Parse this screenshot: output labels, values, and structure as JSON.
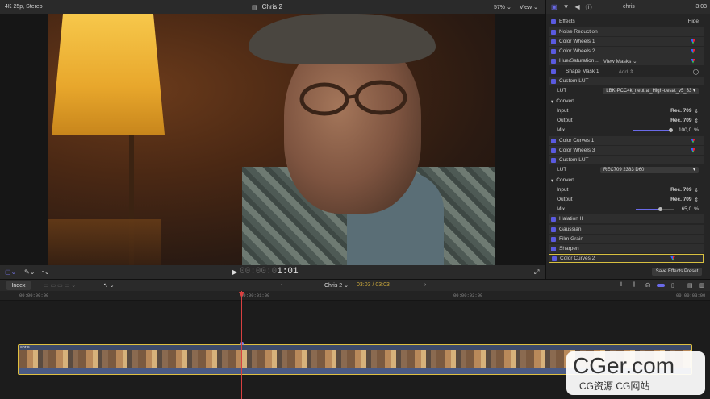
{
  "viewer": {
    "format": "4K 25p, Stereo",
    "title": "Chris 2",
    "zoom": "57%",
    "view_label": "View",
    "timecode_dim": "00:00:0",
    "timecode_bright": "1:01"
  },
  "inspector": {
    "clip_name": "chris",
    "duration": "3:03",
    "effects_header": "Effects",
    "hide_label": "Hide",
    "save_preset": "Save Effects Preset",
    "rows": {
      "noise_reduction": "Noise Reduction",
      "color_wheels_1": "Color Wheels 1",
      "color_wheels_2": "Color Wheels 2",
      "hue_saturation": "Hue/Saturation...",
      "view_masks": "View Masks",
      "shape_mask_1": "Shape Mask 1",
      "add_label": "Add",
      "custom_lut_1": "Custom LUT",
      "lut_label_1": "LUT",
      "lut_value_1": "LBK-PCC4k_neutral_High-desat_v5_33",
      "convert_1": "Convert",
      "input_label_1": "Input",
      "input_value_1": "Rec. 709",
      "output_label_1": "Output",
      "output_value_1": "Rec. 709",
      "mix_label_1": "Mix",
      "mix_value_1": "100,0",
      "mix_unit_1": "%",
      "color_curves_1": "Color Curves 1",
      "color_wheels_3": "Color Wheels 3",
      "custom_lut_2": "Custom LUT",
      "lut_label_2": "LUT",
      "lut_value_2": "REC709 2383 D60",
      "convert_2": "Convert",
      "input_label_2": "Input",
      "input_value_2": "Rec. 709",
      "output_label_2": "Output",
      "output_value_2": "Rec. 709",
      "mix_label_2": "Mix",
      "mix_value_2": "65,0",
      "mix_unit_2": "%",
      "halation": "Halation II",
      "gaussian": "Gaussian",
      "film_grain": "Film Grain",
      "sharpen": "Sharpen",
      "color_curves_2": "Color Curves 2"
    },
    "mix_level_1": 1.0,
    "mix_level_2": 0.65
  },
  "timeline": {
    "index_label": "Index",
    "project_name": "Chris 2",
    "position": "03:03 / 03:03",
    "ruler": [
      "00:00:00:00",
      "00:00:01:00",
      "00:00:02:00",
      "00:00:03:00"
    ],
    "clip_label": "chris"
  },
  "watermark": {
    "big": "CGer.com",
    "small": "CG资源 CG网站"
  },
  "colors": {
    "accent": "#5a5ae0",
    "clip_border": "#e0c040",
    "playhead": "#d84040"
  }
}
